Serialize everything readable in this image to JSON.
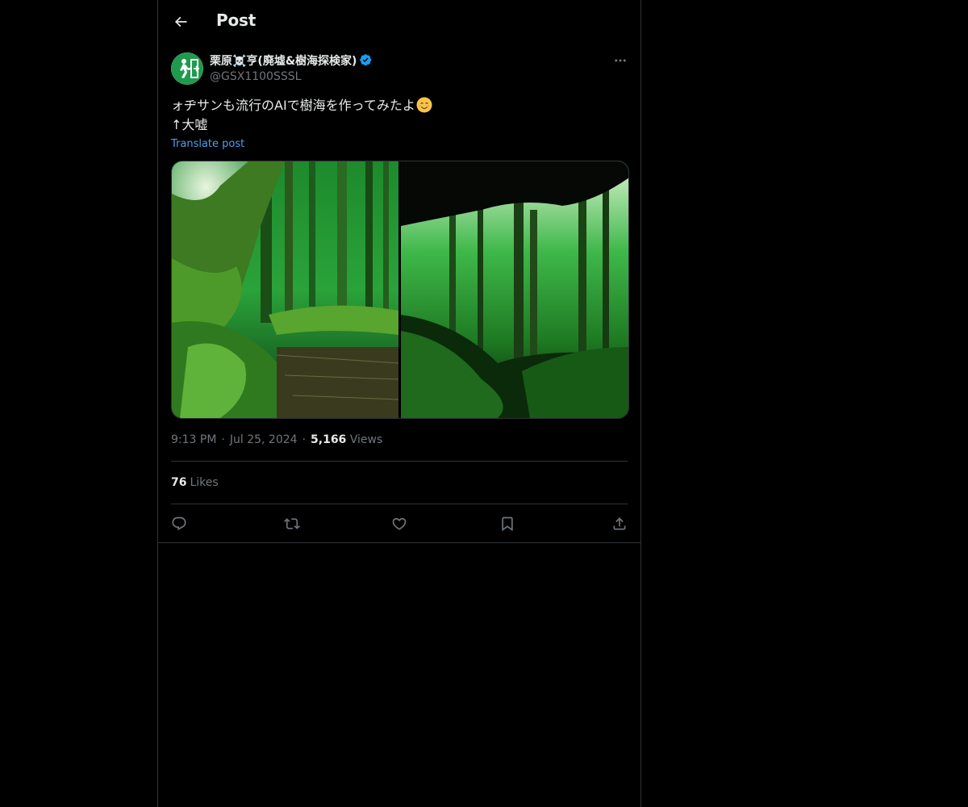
{
  "header": {
    "title": "Post",
    "back_icon": "back-arrow-icon"
  },
  "post": {
    "author": {
      "display_name": "栗原☠️亨(廃墟&樹海探検家)",
      "handle": "@GSX1100SSSL",
      "verified": true,
      "verified_color": "#1d9bf0"
    },
    "text_line1": "ォヂサンも流行のAIで樹海を作ってみたよ",
    "text_line2": "↑大嘘",
    "text_emoji": "smiling-face-emoji",
    "translate_label": "Translate post",
    "images": [
      {
        "name": "forest-photo-mossy-roots"
      },
      {
        "name": "forest-photo-cave-view"
      }
    ],
    "meta": {
      "time": "9:13 PM",
      "date": "Jul 25, 2024",
      "views_count": "5,166",
      "views_label": "Views"
    },
    "likes": {
      "count": "76",
      "label": "Likes"
    },
    "actions": [
      "reply-icon",
      "repost-icon",
      "like-icon",
      "bookmark-icon",
      "share-icon"
    ]
  },
  "colors": {
    "background": "#000000",
    "border": "#2f3336",
    "text_primary": "#e7e9ea",
    "text_secondary": "#71767b",
    "link": "#4d9ef0"
  }
}
